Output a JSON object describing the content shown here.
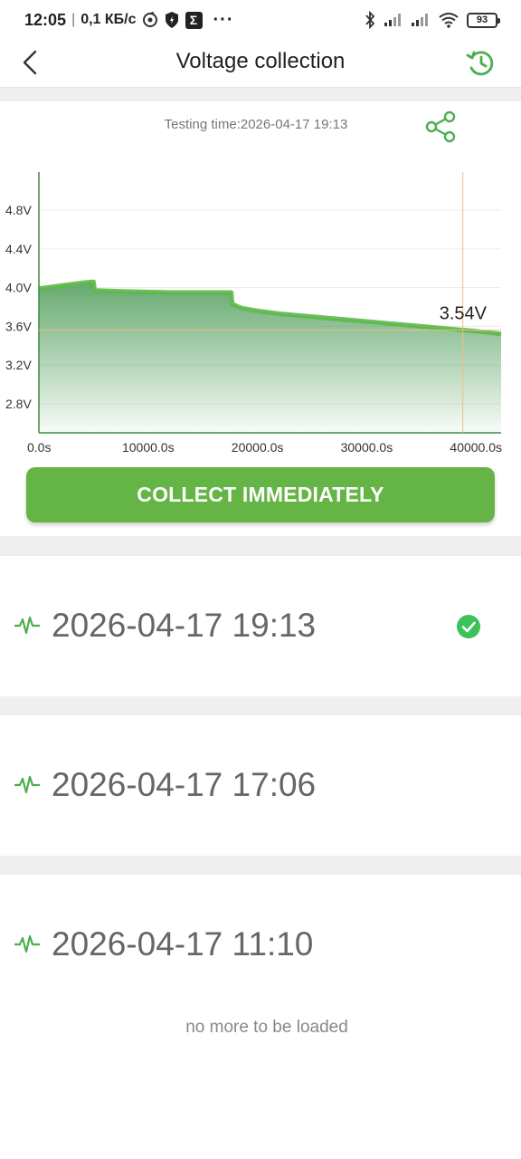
{
  "status_bar": {
    "time": "12:05",
    "network_speed": "0,1 КБ/с",
    "battery": "93"
  },
  "header": {
    "title": "Voltage collection",
    "accent_color": "#4cae4f"
  },
  "chart_section": {
    "testing_time_label": "Testing time:2026-04-17 19:13",
    "collect_button_label": "COLLECT IMMEDIATELY",
    "button_color": "#64b545"
  },
  "chart_data": {
    "type": "area",
    "title": "",
    "xlabel": "",
    "ylabel": "",
    "x_tick_labels": [
      "0.0s",
      "10000.0s",
      "20000.0s",
      "30000.0s",
      "40000.0s"
    ],
    "x_ticks": [
      0,
      10000,
      20000,
      30000,
      40000
    ],
    "y_tick_labels": [
      "2.8V",
      "3.2V",
      "3.6V",
      "4.0V",
      "4.4V",
      "4.8V"
    ],
    "y_ticks": [
      2.8,
      3.2,
      3.6,
      4.0,
      4.4,
      4.8
    ],
    "xlim": [
      0,
      42300
    ],
    "ylim": [
      2.5,
      5.1
    ],
    "series": [
      {
        "x": [
          0,
          2000,
          4000,
          5000,
          5100,
          8000,
          12000,
          16000,
          17600,
          17700,
          18500,
          20000,
          22000,
          24000,
          26000,
          28000,
          30000,
          32000,
          34000,
          36000,
          38000,
          40000,
          42300
        ],
        "values": [
          3.99,
          4.02,
          4.05,
          4.06,
          3.97,
          3.96,
          3.95,
          3.95,
          3.95,
          3.83,
          3.79,
          3.76,
          3.73,
          3.71,
          3.69,
          3.67,
          3.65,
          3.63,
          3.61,
          3.59,
          3.57,
          3.55,
          3.52
        ]
      }
    ],
    "cursor": {
      "x": 38800,
      "value_label": "3.54V",
      "crosshair_value": 3.56
    },
    "grid": true,
    "line_color": "#5cb848"
  },
  "records": [
    {
      "time": "2026-04-17 19:13",
      "selected": true
    },
    {
      "time": "2026-04-17 17:06",
      "selected": false
    },
    {
      "time": "2026-04-17 11:10",
      "selected": false
    }
  ],
  "footer": {
    "no_more_label": "no more to be loaded"
  }
}
